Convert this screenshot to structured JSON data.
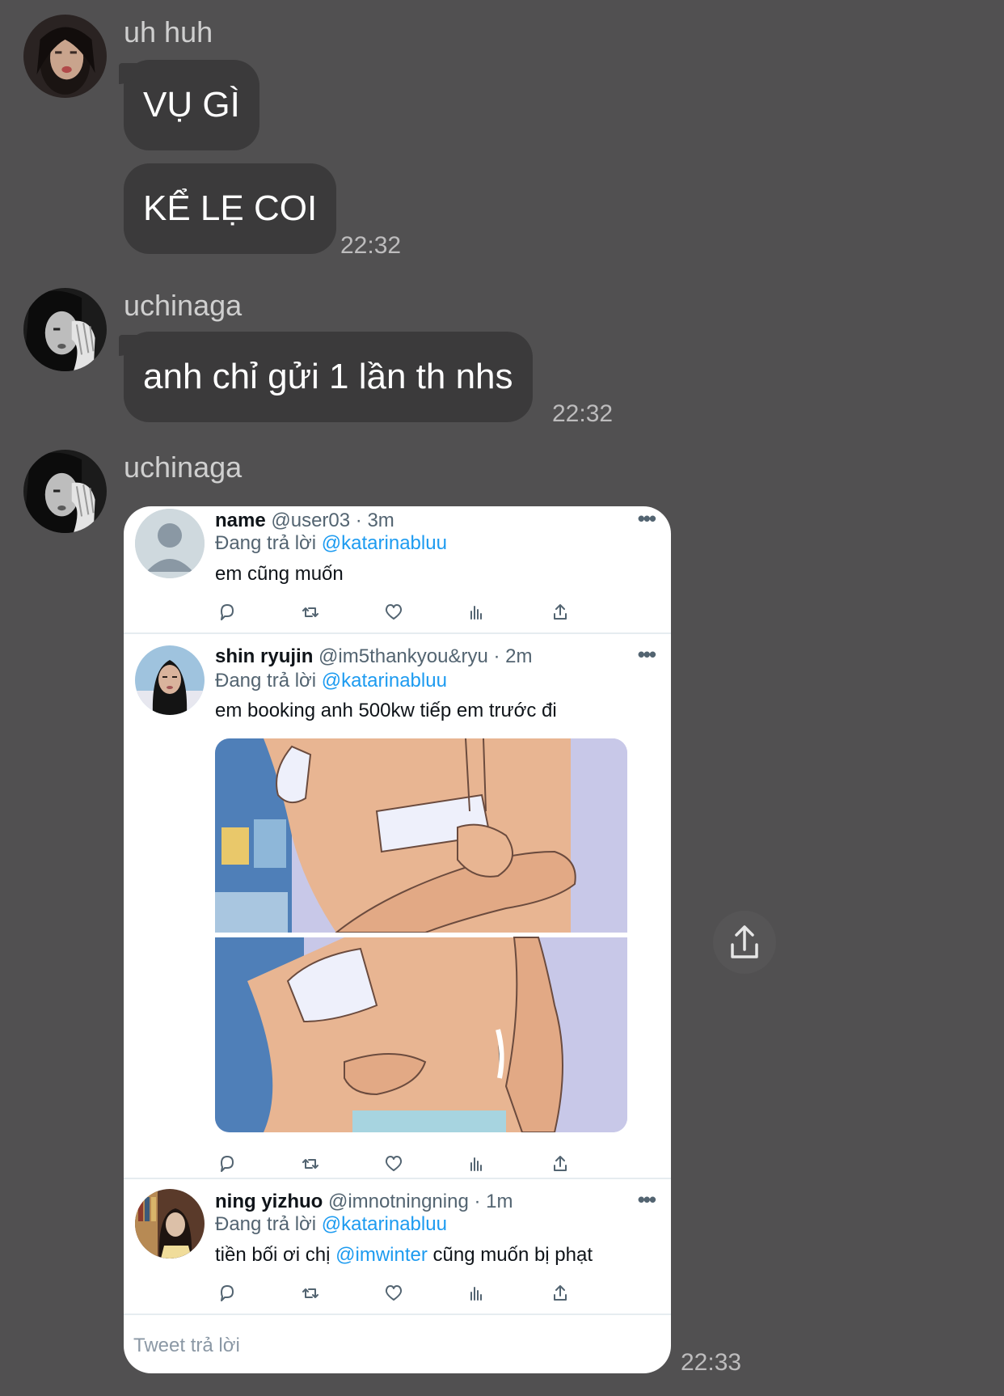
{
  "messages": [
    {
      "sender": "uh huh",
      "bubbles": [
        "VỤ GÌ",
        "KỂ LẸ COI"
      ],
      "time": "22:32"
    },
    {
      "sender": "uchinaga",
      "bubbles": [
        "anh chỉ gửi 1 lần th nhs"
      ],
      "time": "22:32"
    },
    {
      "sender": "uchinaga",
      "time": "22:33"
    }
  ],
  "tweet_card": {
    "tweets": [
      {
        "name": "name",
        "handle": "@user03 · 3m",
        "reply_prefix": "Đang trả lời",
        "reply_to": "@katarinabluu",
        "text": "em cũng muốn"
      },
      {
        "name": "shin ryujin",
        "handle": "@im5thankyou&ryu · 2m",
        "reply_prefix": "Đang trả lời",
        "reply_to": "@katarinabluu",
        "text": "em booking anh 500kw tiếp em trước đi"
      },
      {
        "name": "ning yizhuo",
        "handle": "@imnotningning · 1m",
        "reply_prefix": "Đang trả lời",
        "reply_to": "@katarinabluu",
        "text_before": "tiền bối ơi chị ",
        "text_mention": "@imwinter",
        "text_after": " cũng muốn bị phạt"
      }
    ],
    "more_glyph": "•••",
    "reply_placeholder": "Tweet trả lời"
  },
  "icons": {
    "reply": "comment-icon",
    "retweet": "retweet-icon",
    "like": "heart-icon",
    "views": "analytics-icon",
    "share": "share-icon",
    "forward": "forward-share-icon"
  },
  "colors": {
    "background": "#515051",
    "bubble": "#3b3a3b",
    "mention": "#1d9bf0"
  }
}
